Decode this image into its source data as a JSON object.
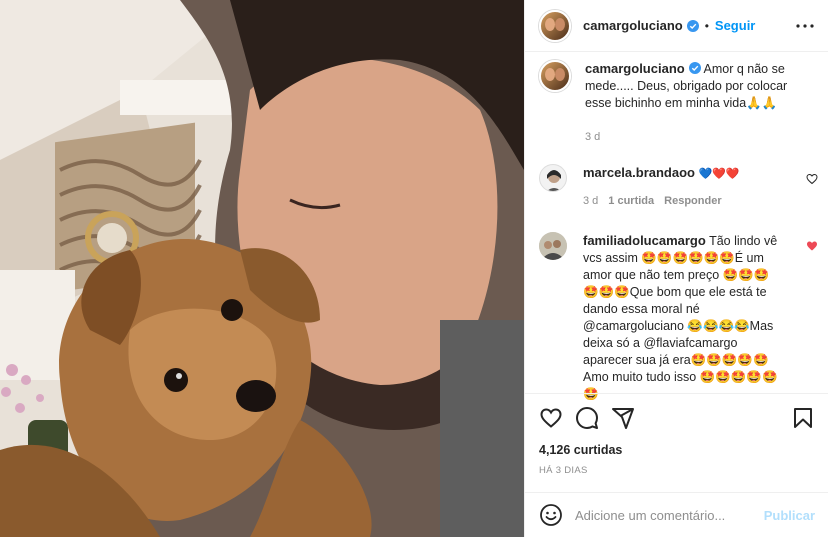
{
  "post": {
    "author": "camargoluciano",
    "follow_label": "Seguir",
    "separator": "•",
    "caption": {
      "author": "camargoluciano",
      "text": "Amor q não se mede..... Deus, obrigado por colocar esse bichinho em minha vida🙏🙏",
      "age": "3 d"
    },
    "comments": [
      {
        "author": "marcela.brandaoo",
        "text": "💙❤️❤️",
        "age": "3 d",
        "likes": "1 curtida",
        "reply_label": "Responder",
        "liked": false
      },
      {
        "author": "familiadolucamargo",
        "text": "Tão lindo vê vcs assim 🤩🤩🤩🤩🤩🤩É um amor que não tem preço 🤩🤩🤩🤩🤩🤩Que bom que ele está te dando essa moral né @camargoluciano 😂😂😂😂Mas deixa só a @flaviafcamargo aparecer sua já era🤩🤩🤩🤩🤩Amo muito tudo isso 🤩🤩🤩🤩🤩🤩",
        "liked": true
      }
    ],
    "likes_count": "4,126 curtidas",
    "posted_when": "HÁ 3 DIAS",
    "add_comment_placeholder": "Adicione um comentário...",
    "publish_label": "Publicar"
  },
  "colors": {
    "accent": "#0095f6",
    "heart": "#ed4956",
    "publish_disabled": "#b2dffc",
    "muted": "#8e8e8e"
  },
  "icons": [
    "verified-badge-icon",
    "more-options-icon",
    "heart-icon",
    "comment-icon",
    "share-icon",
    "bookmark-icon",
    "emoji-icon"
  ]
}
